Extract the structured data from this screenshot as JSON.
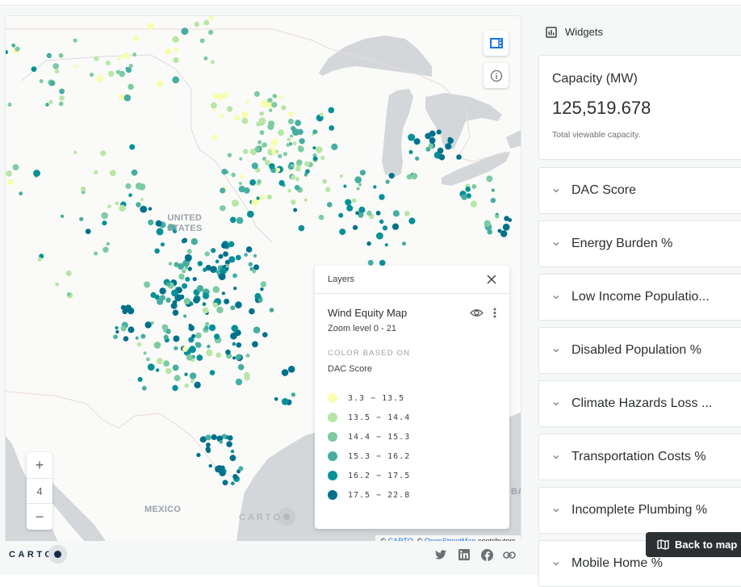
{
  "map": {
    "labels": {
      "country_us_line1": "UNITED",
      "country_us_line2": "STATES",
      "country_mexico": "MEXICO",
      "gulf_partial": "BA"
    },
    "controls": {
      "sidebar_toggle_icon": "sidebar-panel-icon",
      "info_icon": "info-icon",
      "zoom_in_label": "+",
      "zoom_level": "4",
      "zoom_out_label": "−"
    },
    "watermark": "CARTO",
    "attribution": {
      "prefix": "©",
      "carto_link": "CARTO",
      "separator": ", ©",
      "osm_link": "OpenStreetMap",
      "suffix": "contributors"
    },
    "point_colors": [
      "#f7feae",
      "#b7e6a5",
      "#7ccba2",
      "#46aea0",
      "#089099",
      "#00718b"
    ]
  },
  "layers_panel": {
    "title": "Layers",
    "close_icon": "close-icon",
    "layer": {
      "name": "Wind Equity Map",
      "zoom_range": "Zoom level 0 - 21",
      "visibility_icon": "eye-icon",
      "menu_icon": "more-vert-icon",
      "color_caption": "COLOR BASED ON",
      "color_field": "DAC Score",
      "legend": [
        {
          "label": "3.3 − 13.5",
          "color": "#f7feae"
        },
        {
          "label": "13.5 − 14.4",
          "color": "#b7e6a5"
        },
        {
          "label": "14.4 − 15.3",
          "color": "#7ccba2"
        },
        {
          "label": "15.3 − 16.2",
          "color": "#46aea0"
        },
        {
          "label": "16.2 − 17.5",
          "color": "#089099"
        },
        {
          "label": "17.5 − 22.8",
          "color": "#00718b"
        }
      ]
    }
  },
  "footer": {
    "logo": "CARTO",
    "social": [
      "twitter-icon",
      "linkedin-icon",
      "facebook-icon",
      "link-icon"
    ]
  },
  "sidebar": {
    "header": "Widgets",
    "capacity": {
      "title": "Capacity (MW)",
      "value": "125,519.678",
      "note": "Total viewable capacity."
    },
    "widgets": [
      "DAC Score",
      "Energy Burden %",
      "Low Income Populatio...",
      "Disabled Population %",
      "Climate Hazards Loss ...",
      "Transportation Costs %",
      "Incomplete Plumbing %",
      "Mobile Home %"
    ],
    "back_button": "Back to map"
  }
}
